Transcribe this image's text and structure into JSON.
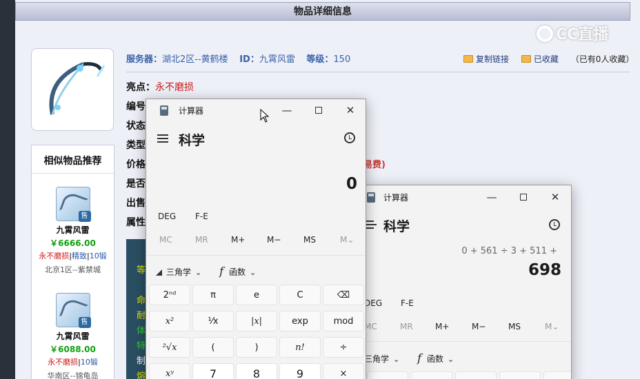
{
  "webpage": {
    "header_title": "物品详细信息",
    "watermark_text": "CC直播",
    "info": {
      "server_label": "服务器：",
      "server_value": "湖北2区--黄鹤楼",
      "id_label": "ID：",
      "id_value": "九霄风雷",
      "level_label": "等级：",
      "level_value": "150"
    },
    "actions": {
      "copy_link": "复制链接",
      "favorited": "已收藏",
      "fav_count_text": "（已有0人收藏）"
    },
    "attrs": {
      "highlight_label": "亮点：",
      "highlight_value": "永不磨损",
      "number_label": "编号",
      "status_label": "状态",
      "type_label": "类型",
      "price_label": "价格",
      "whether_label": "是否",
      "sale_label": "出售",
      "property_label": "属性",
      "fee_fragment": "易费)"
    },
    "similar": {
      "title": "相似物品推荐",
      "items": [
        {
          "name": "九霄风雷",
          "price": "￥6666.00",
          "tag1": "永不磨损",
          "tag2": "精致",
          "tag3": "10锻",
          "server": "北京1区--紫禁城",
          "sale_badge": "售"
        },
        {
          "name": "九霄风雷",
          "price": "￥6088.00",
          "tag1": "永不磨损",
          "tag2": "10锻",
          "server": "华南区--锦龟岛",
          "sale_badge": "售"
        }
      ]
    },
    "detail_fragments": [
      "等",
      "命",
      "耐",
      "体",
      "特",
      "制",
      "熔"
    ]
  },
  "calc_front": {
    "title": "计算器",
    "mode": "科学",
    "display": "0",
    "angle_unit": "DEG",
    "fe": "F-E",
    "memory": [
      "MC",
      "MR",
      "M+",
      "M−",
      "MS",
      "M⌄"
    ],
    "trig": "三角学",
    "func": "函数",
    "keys": [
      [
        "2ⁿᵈ",
        "π",
        "e",
        "C",
        "⌫"
      ],
      [
        "x²",
        "¹⁄x",
        "|x|",
        "exp",
        "mod"
      ],
      [
        "²√x",
        "(",
        ")",
        "n!",
        "÷"
      ],
      [
        "xʸ",
        "7",
        "8",
        "9",
        "×"
      ]
    ]
  },
  "calc_back": {
    "title": "计算器",
    "mode": "科学",
    "expression": "0 + 561 ÷ 3 + 511 +",
    "display": "698",
    "angle_unit": "DEG",
    "fe": "F-E",
    "memory": [
      "MC",
      "MR",
      "M+",
      "M−",
      "MS",
      "M⌄"
    ],
    "trig": "三角学",
    "func": "函数"
  },
  "window_controls": {
    "minimize": "—",
    "close": "✕"
  }
}
